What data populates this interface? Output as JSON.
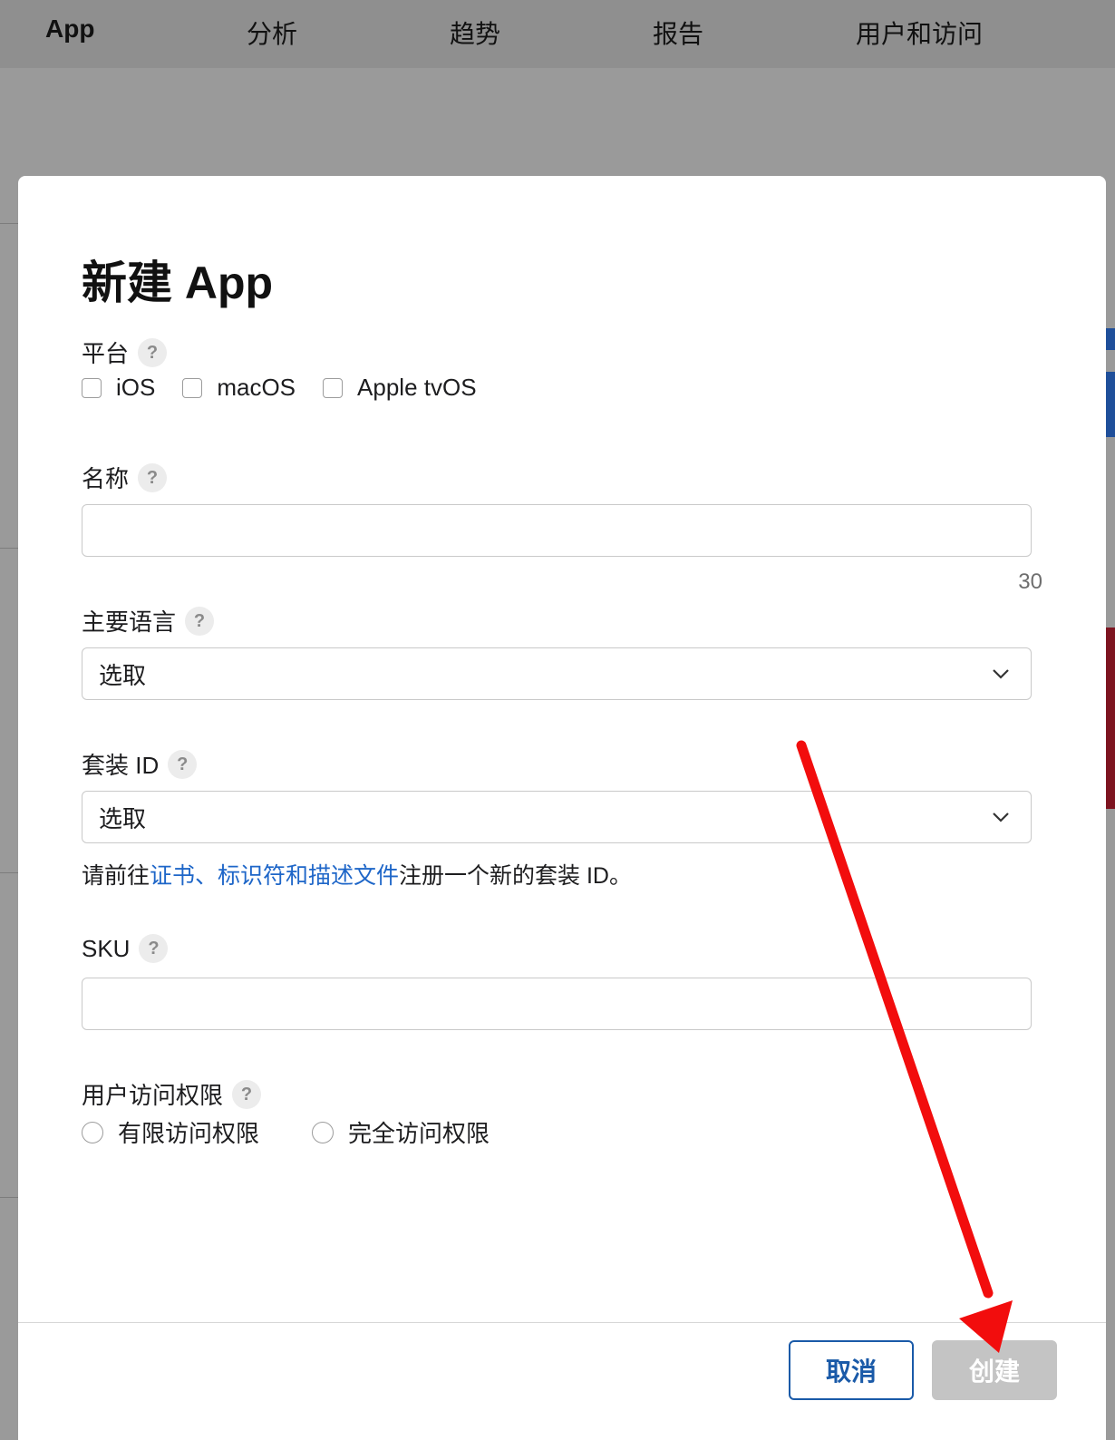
{
  "nav": {
    "items": [
      "App",
      "分析",
      "趋势",
      "报告",
      "用户和访问"
    ]
  },
  "modal": {
    "title": "新建 App",
    "platform": {
      "label": "平台",
      "help": "?",
      "options": [
        "iOS",
        "macOS",
        "Apple tvOS"
      ]
    },
    "name": {
      "label": "名称",
      "help": "?",
      "value": "",
      "counter": "30"
    },
    "language": {
      "label": "主要语言",
      "help": "?",
      "value": "选取"
    },
    "bundle": {
      "label": "套装 ID",
      "help": "?",
      "value": "选取",
      "hint_prefix": "请前往",
      "hint_link": "证书、标识符和描述文件",
      "hint_suffix": "注册一个新的套装 ID。"
    },
    "sku": {
      "label": "SKU",
      "help": "?",
      "value": ""
    },
    "access": {
      "label": "用户访问权限",
      "help": "?",
      "options": [
        "有限访问权限",
        "完全访问权限"
      ]
    },
    "buttons": {
      "cancel": "取消",
      "create": "创建"
    }
  },
  "colors": {
    "link": "#1e66c8",
    "primary": "#1a5aa8",
    "disabled_button": "#c4c4c4",
    "annotation_arrow": "#f20d0d"
  }
}
